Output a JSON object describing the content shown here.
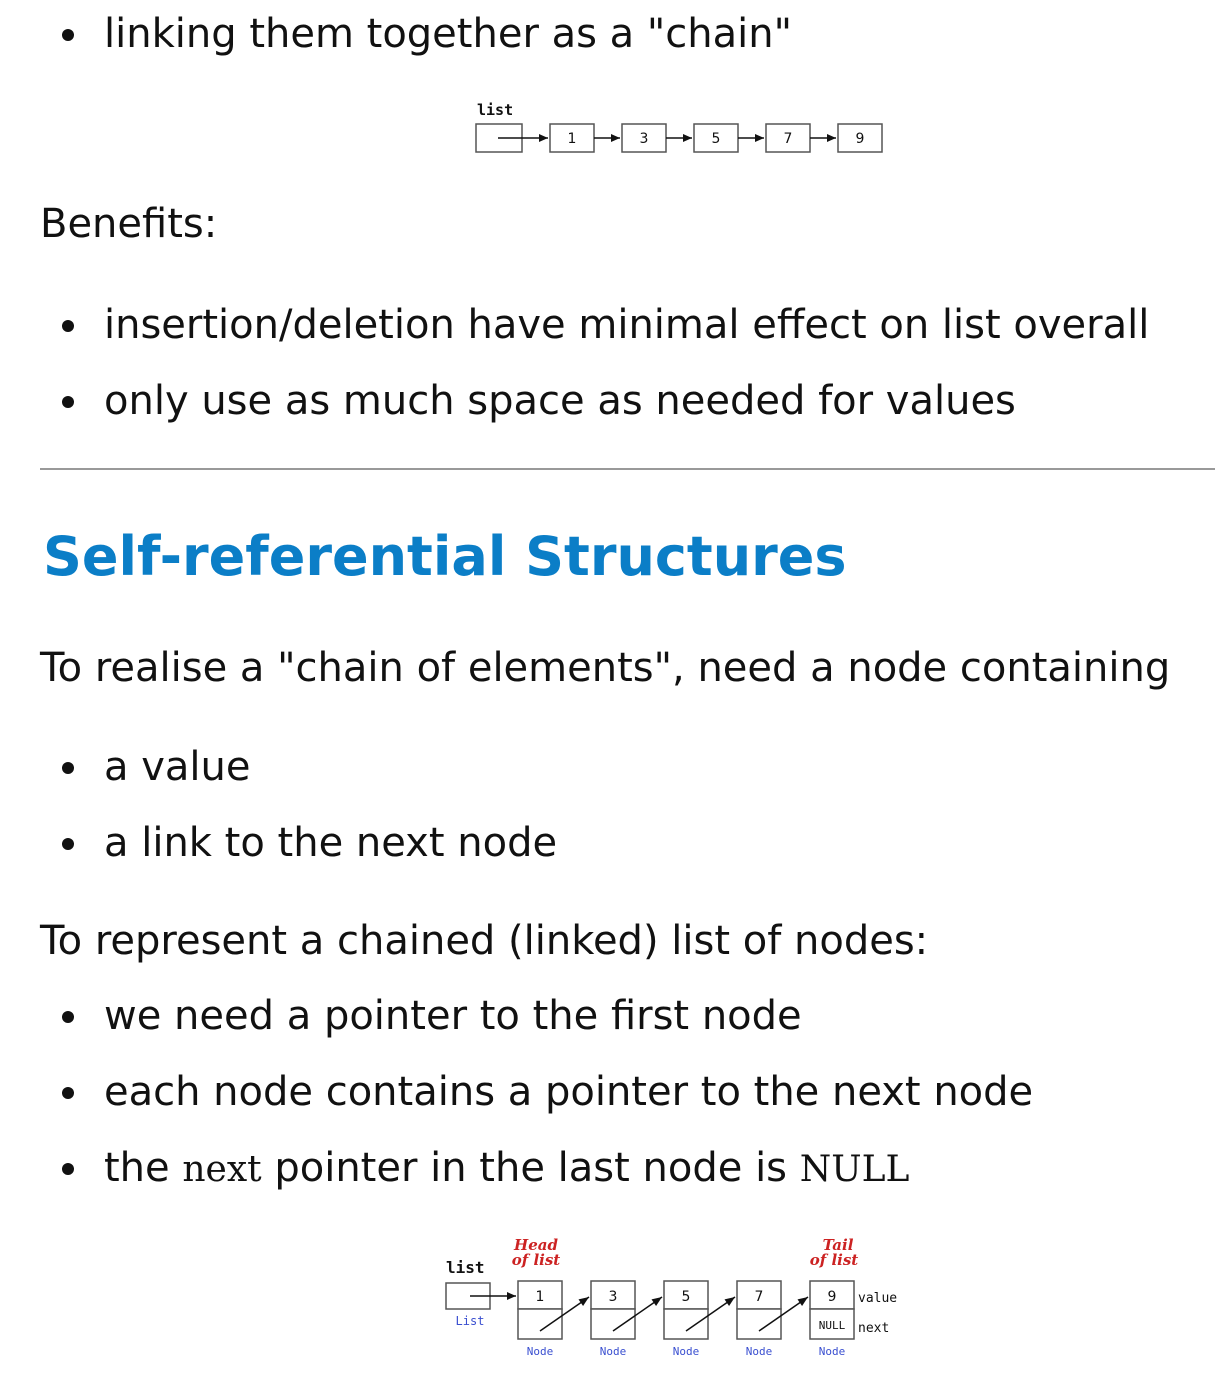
{
  "intro_bullet": "linking them together as a \"chain\"",
  "diagram1": {
    "list_label": "list",
    "values": [
      "1",
      "3",
      "5",
      "7",
      "9"
    ]
  },
  "benefits": {
    "label": "Benefits:",
    "items": [
      "insertion/deletion have minimal effect on list overall",
      "only use as much space as needed for values"
    ]
  },
  "section": {
    "title": "Self-referential Structures",
    "para1": "To realise a \"chain of elements\", need a node containing",
    "node_items": [
      "a value",
      "a link to the next node"
    ],
    "para2": "To represent a chained (linked) list of nodes:",
    "list_items": [
      "we need a pointer to the first node",
      "each node contains a pointer to the next node"
    ],
    "last_item": {
      "pre": "the ",
      "code1": "next",
      "mid": " pointer in the last node is ",
      "code2": "NULL"
    }
  },
  "diagram2": {
    "list_label": "list",
    "list_type": "List",
    "head_label": [
      "Head",
      "of list"
    ],
    "tail_label": [
      "Tail",
      "of list"
    ],
    "values": [
      "1",
      "3",
      "5",
      "7",
      "9"
    ],
    "node_type": "Node",
    "null_label": "NULL",
    "value_field": "value",
    "next_field": "next"
  },
  "colors": {
    "heading": "#0b7ec7",
    "annotation_red": "#cc2222",
    "type_blue": "#3a4fd0",
    "rule": "#999999"
  }
}
